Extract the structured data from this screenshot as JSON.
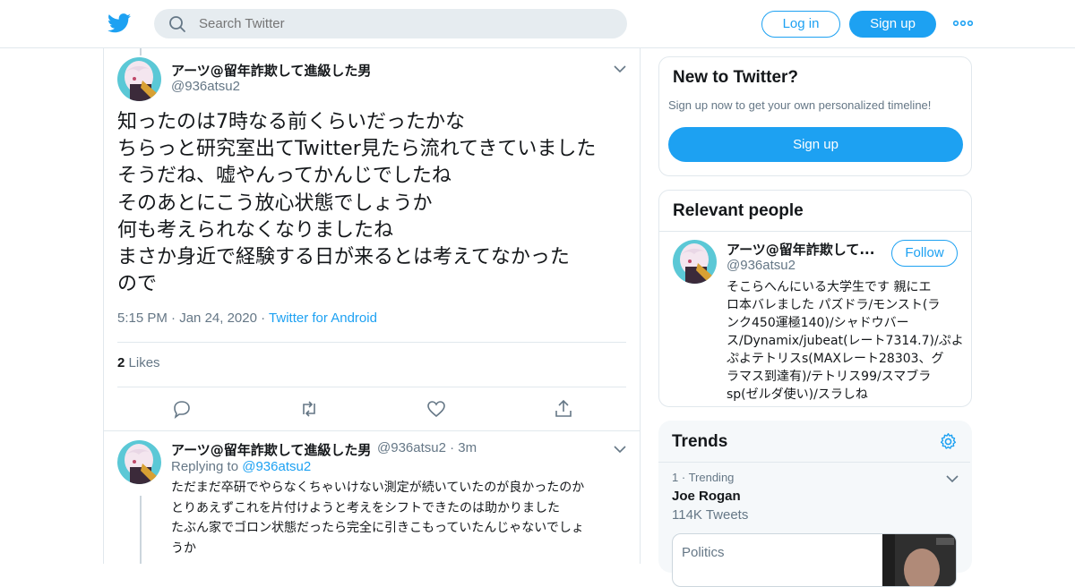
{
  "header": {
    "search_placeholder": "Search Twitter",
    "login_label": "Log in",
    "signup_label": "Sign up"
  },
  "tweet": {
    "author_name": "アーツ@留年詐欺して進級した男",
    "author_handle": "@936atsu2",
    "text_lines": [
      "知ったのは7時なる前くらいだったかな",
      "ちらっと研究室出てTwitter見たら流れてきていました",
      "そうだね、嘘やんってかんじでしたね",
      "そのあとにこう放心状態でしょうか",
      "何も考えられなくなりましたね",
      "まさか身近で経験する日が来るとは考えてなかった",
      "ので"
    ],
    "time": "5:15 PM",
    "date": "Jan 24, 2020",
    "source": "Twitter for Android",
    "likes_count": "2",
    "likes_label": "Likes"
  },
  "reply": {
    "author_name": "アーツ@留年詐欺して進級した男",
    "author_handle": "@936atsu2",
    "age": "3m",
    "replying_to_label": "Replying to",
    "replying_to_handle": "@936atsu2",
    "text_lines": [
      "ただまだ卒研でやらなくちゃいけない測定が続いていたのが良かったのか",
      "とりあえずこれを片付けようと考えをシフトできたのは助かりました",
      "たぶん家でゴロン状態だったら完全に引きこもっていたんじゃないでしょ",
      "うか"
    ]
  },
  "new_to_twitter": {
    "title": "New to Twitter?",
    "subtitle": "Sign up now to get your own personalized timeline!",
    "signup_label": "Sign up"
  },
  "relevant_people": {
    "title": "Relevant people",
    "name": "アーツ@留年詐欺して...",
    "handle": "@936atsu2",
    "follow_label": "Follow",
    "bio_lines": [
      "そこらへんにいる大学生です 親にエ",
      "ロ本バレました パズドラ/モンスト(ラ",
      "ンク450運極140)/シャドウバー",
      "ス/Dynamix/jubeat(レート7314.7)/ぷよ",
      "ぷよテトリスs(MAXレート28303、グ",
      "ラマス到達有)/テトリス99/スマブラ",
      "sp(ゼルダ使い)/スラしね"
    ]
  },
  "trends": {
    "title": "Trends",
    "items": [
      {
        "rank": "1",
        "meta": "Trending",
        "name": "Joe Rogan",
        "count": "114K Tweets"
      }
    ],
    "card_label": "Politics"
  },
  "colors": {
    "accent": "#1da1f2",
    "text": "#14171a",
    "secondary": "#657786",
    "border": "#e1e8ed"
  }
}
